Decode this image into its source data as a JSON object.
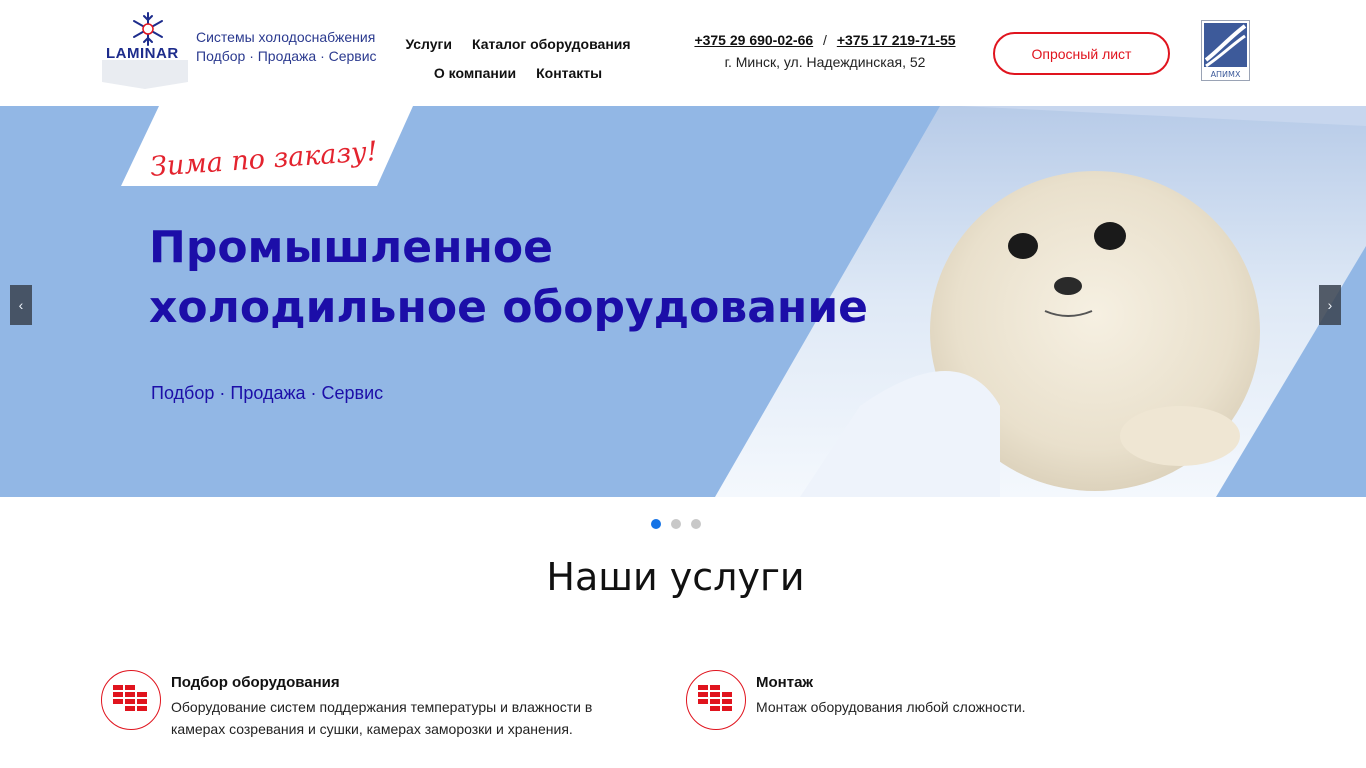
{
  "brand": {
    "logo_text": "LAMINAR",
    "tagline_line1": "Системы холодоснабжения",
    "tagline_line2": "Подбор · Продажа · Сервис"
  },
  "nav": {
    "items": [
      {
        "label": "Услуги"
      },
      {
        "label": "Каталог оборудования"
      },
      {
        "label": "О компании"
      },
      {
        "label": "Контакты"
      }
    ]
  },
  "contacts": {
    "phone1": "+375 29 690-02-66",
    "separator": "/",
    "phone2": "+375 17 219-71-55",
    "address": "г. Минск, ул. Надеждинская, 52"
  },
  "header": {
    "survey_button": "Опросный лист",
    "association_logo_text": "АПИМХ"
  },
  "hero": {
    "slogan": "Зима по заказу!",
    "title": "Промышленное холодильное оборудование",
    "subtitle": "Подбор · Продажа · Сервис",
    "prev_arrow": "‹",
    "next_arrow": "›",
    "slides_total": 3,
    "active_slide": 1
  },
  "services": {
    "title": "Наши услуги",
    "items": [
      {
        "title": "Подбор оборудования",
        "description": "Оборудование систем поддержания температуры и влажности в камерах созревания и сушки, камерах заморозки и хранения."
      },
      {
        "title": "Монтаж",
        "description": "Монтаж оборудования любой сложности."
      }
    ]
  },
  "colors": {
    "accent_red": "#e0141e",
    "hero_blue": "#92b7e5",
    "title_blue": "#1c0ea8",
    "active_dot": "#1473e6"
  }
}
